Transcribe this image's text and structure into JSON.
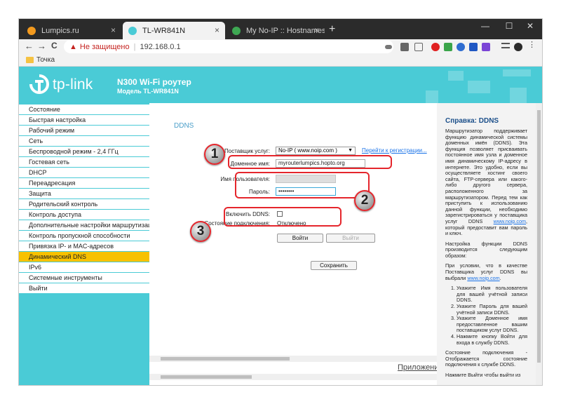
{
  "browser": {
    "tabs": [
      {
        "label": "Lumpics.ru",
        "close": "×"
      },
      {
        "label": "TL-WR841N",
        "close": "×"
      },
      {
        "label": "My No-IP :: Hostnames",
        "close": "×"
      }
    ],
    "new_tab": "+",
    "window_controls": {
      "minimize": "—",
      "maximize": "☐",
      "close": "✕"
    },
    "nav": {
      "back": "←",
      "forward": "→",
      "reload": "C"
    },
    "address": {
      "warning_icon": "▲",
      "insecure_label": "Не защищено",
      "separator": "|",
      "url": "192.168.0.1"
    },
    "bookmark": "Точка"
  },
  "router": {
    "logo_text": "tp-link",
    "title": "N300 Wi-Fi роутер",
    "model": "Модель TL-WR841N",
    "menu": [
      "Состояние",
      "Быстрая настройка",
      "Рабочий режим",
      "Сеть",
      "Беспроводной режим - 2,4 ГГц",
      "Гостевая сеть",
      "DHCP",
      "Переадресация",
      "Защита",
      "Родительский контроль",
      "Контроль доступа",
      "Дополнительные настройки маршрутизации",
      "Контроль пропускной способности",
      "Привязка IP- и MAC-адресов",
      "Динамический DNS",
      "IPv6",
      "Системные инструменты",
      "Выйти"
    ],
    "active_menu": "Динамический DNS"
  },
  "ddns": {
    "heading": "DDNS",
    "provider_label": "Поставщик услуг:",
    "provider_value": "No-IP ( www.noip.com )",
    "register_link": "Перейти к регистрации...",
    "domain_label": "Доменное имя:",
    "domain_value": "myrouterlumpics.hopto.org",
    "username_label": "Имя пользователя:",
    "password_label": "Пароль:",
    "password_value": "••••••••",
    "enable_label": "Включить DDNS:",
    "status_label": "Состояние подключения:",
    "status_value": "Отключено",
    "login_button": "Войти",
    "logout_button": "Выйти",
    "save_button": "Сохранить",
    "apps_link": "Приложение"
  },
  "help": {
    "title": "Справка: DDNS",
    "p1": "Маршрутизатор поддерживает функцию динамической системы доменных имён (DDNS). Эта функция позволяет присваивать постоянное имя узла и доменное имя динамическому IP-адресу в интернете. Это удобно, если вы осуществляете хостинг своего сайта, FTP-сервера или какого-либо другого сервера, расположенного за маршрутизатором. Перед тем как приступить к использованию данной функции, необходимо зарегистрироваться у поставщика услуг DDNS",
    "p1_link": "www.noip.com",
    "p1_end": ", который предоставит вам пароль и ключ.",
    "p2": "Настройка функции DDNS производится следующим образом:",
    "p3": "При условии, что в качестве Поставщика услуг DDNS вы выбрали",
    "p3_link": "www.noip.com",
    "steps": [
      "Укажите Имя пользователя для вашей учётной записи DDNS.",
      "Укажите Пароль для вашей учётной записи DDNS.",
      "Укажите Доменное имя предоставленное вашим поставщиком услуг DDNS.",
      "Нажмите кнопку Войти для входа в службу DDNS."
    ],
    "p4": "Состояние подключения - Отображается состояние подключения к службе DDNS.",
    "p5": "Нажмите Выйти чтобы выйти из"
  },
  "annotations": [
    "1",
    "2",
    "3"
  ],
  "colors": {
    "tplink_teal": "#4acbd6",
    "active_menu": "#f7c100",
    "annotation_red": "#e5262c",
    "insecure_red": "#c5221f"
  }
}
